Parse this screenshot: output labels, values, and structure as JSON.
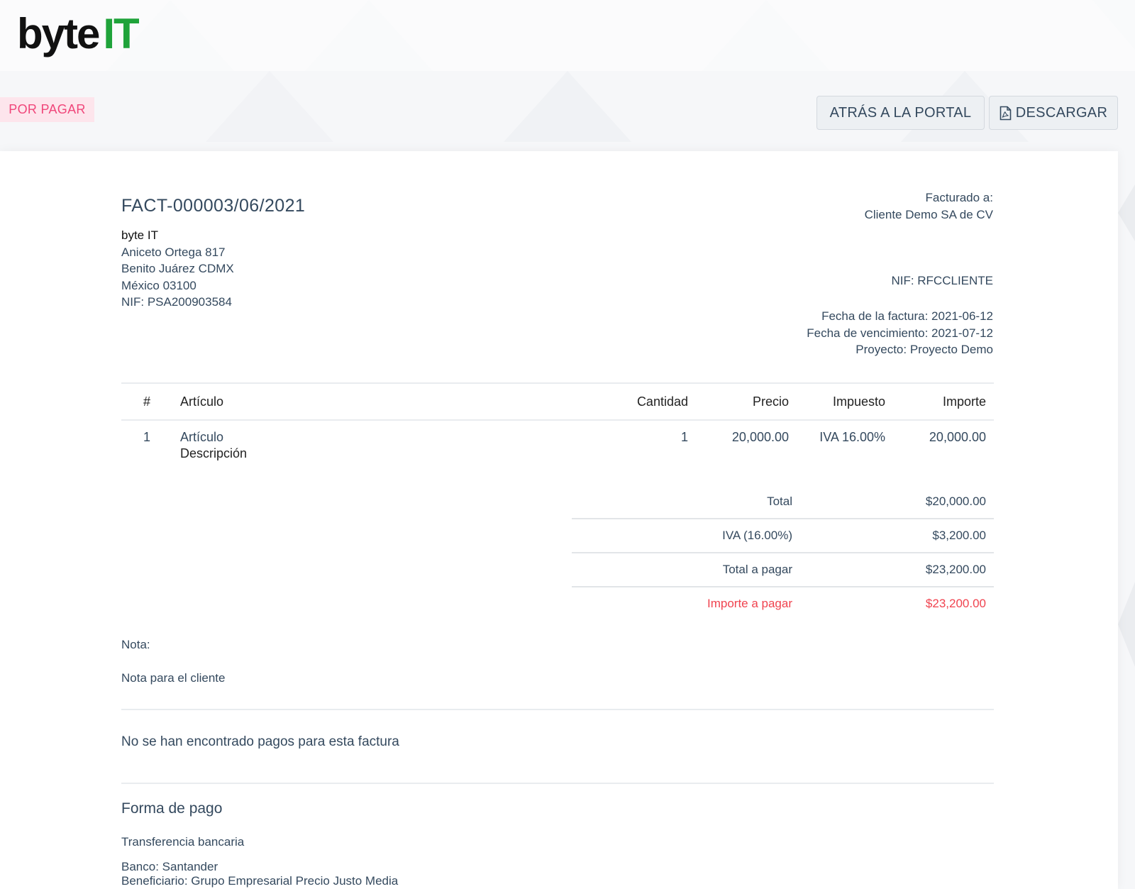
{
  "brand": {
    "logo_part1": "byte",
    "logo_part2": "IT",
    "logo_color_dark": "#111111",
    "logo_color_green": "#1fa33a"
  },
  "status_badge": {
    "label": "POR PAGAR",
    "color": "#f0467a",
    "bg": "#fde5ec"
  },
  "toolbar": {
    "back_label": "ATRÁS A LA PORTAL",
    "download_label": "DESCARGAR",
    "download_icon": "file-pdf-icon"
  },
  "invoice": {
    "number": "FACT-000003/06/2021",
    "from": {
      "company": "byte IT",
      "address1": "Aniceto Ortega 817",
      "address2": "Benito Juárez CDMX",
      "address3": "México 03100",
      "tax_id": "NIF: PSA200903584"
    },
    "to": {
      "billed_to_label": "Facturado a:",
      "client": "Cliente Demo SA de CV",
      "tax_id": "NIF: RFCCLIENTE",
      "invoice_date": "Fecha de la factura: 2021-06-12",
      "due_date": "Fecha de vencimiento: 2021-07-12",
      "project": "Proyecto: Proyecto Demo"
    }
  },
  "items_table": {
    "headers": {
      "num": "#",
      "item": "Artículo",
      "qty": "Cantidad",
      "price": "Precio",
      "tax": "Impuesto",
      "amount": "Importe"
    },
    "rows": [
      {
        "num": "1",
        "item": "Artículo",
        "description": "Descripción",
        "qty": "1",
        "price": "20,000.00",
        "tax": "IVA 16.00%",
        "amount": "20,000.00"
      }
    ]
  },
  "totals": {
    "subtotal": {
      "label": "Total",
      "value": "$20,000.00"
    },
    "tax": {
      "label": "IVA (16.00%)",
      "value": "$3,200.00"
    },
    "total": {
      "label": "Total a pagar",
      "value": "$23,200.00"
    },
    "amount_due": {
      "label": "Importe a pagar",
      "value": "$23,200.00",
      "color": "#f0434f"
    }
  },
  "notes": {
    "label": "Nota:",
    "text": "Nota para el cliente"
  },
  "payments": {
    "empty_text": "No se han encontrado pagos para esta factura"
  },
  "payment_method": {
    "title": "Forma de pago",
    "name": "Transferencia bancaria",
    "bank": "Banco: Santander",
    "beneficiary": "Beneficiario: Grupo Empresarial Precio Justo Media"
  }
}
